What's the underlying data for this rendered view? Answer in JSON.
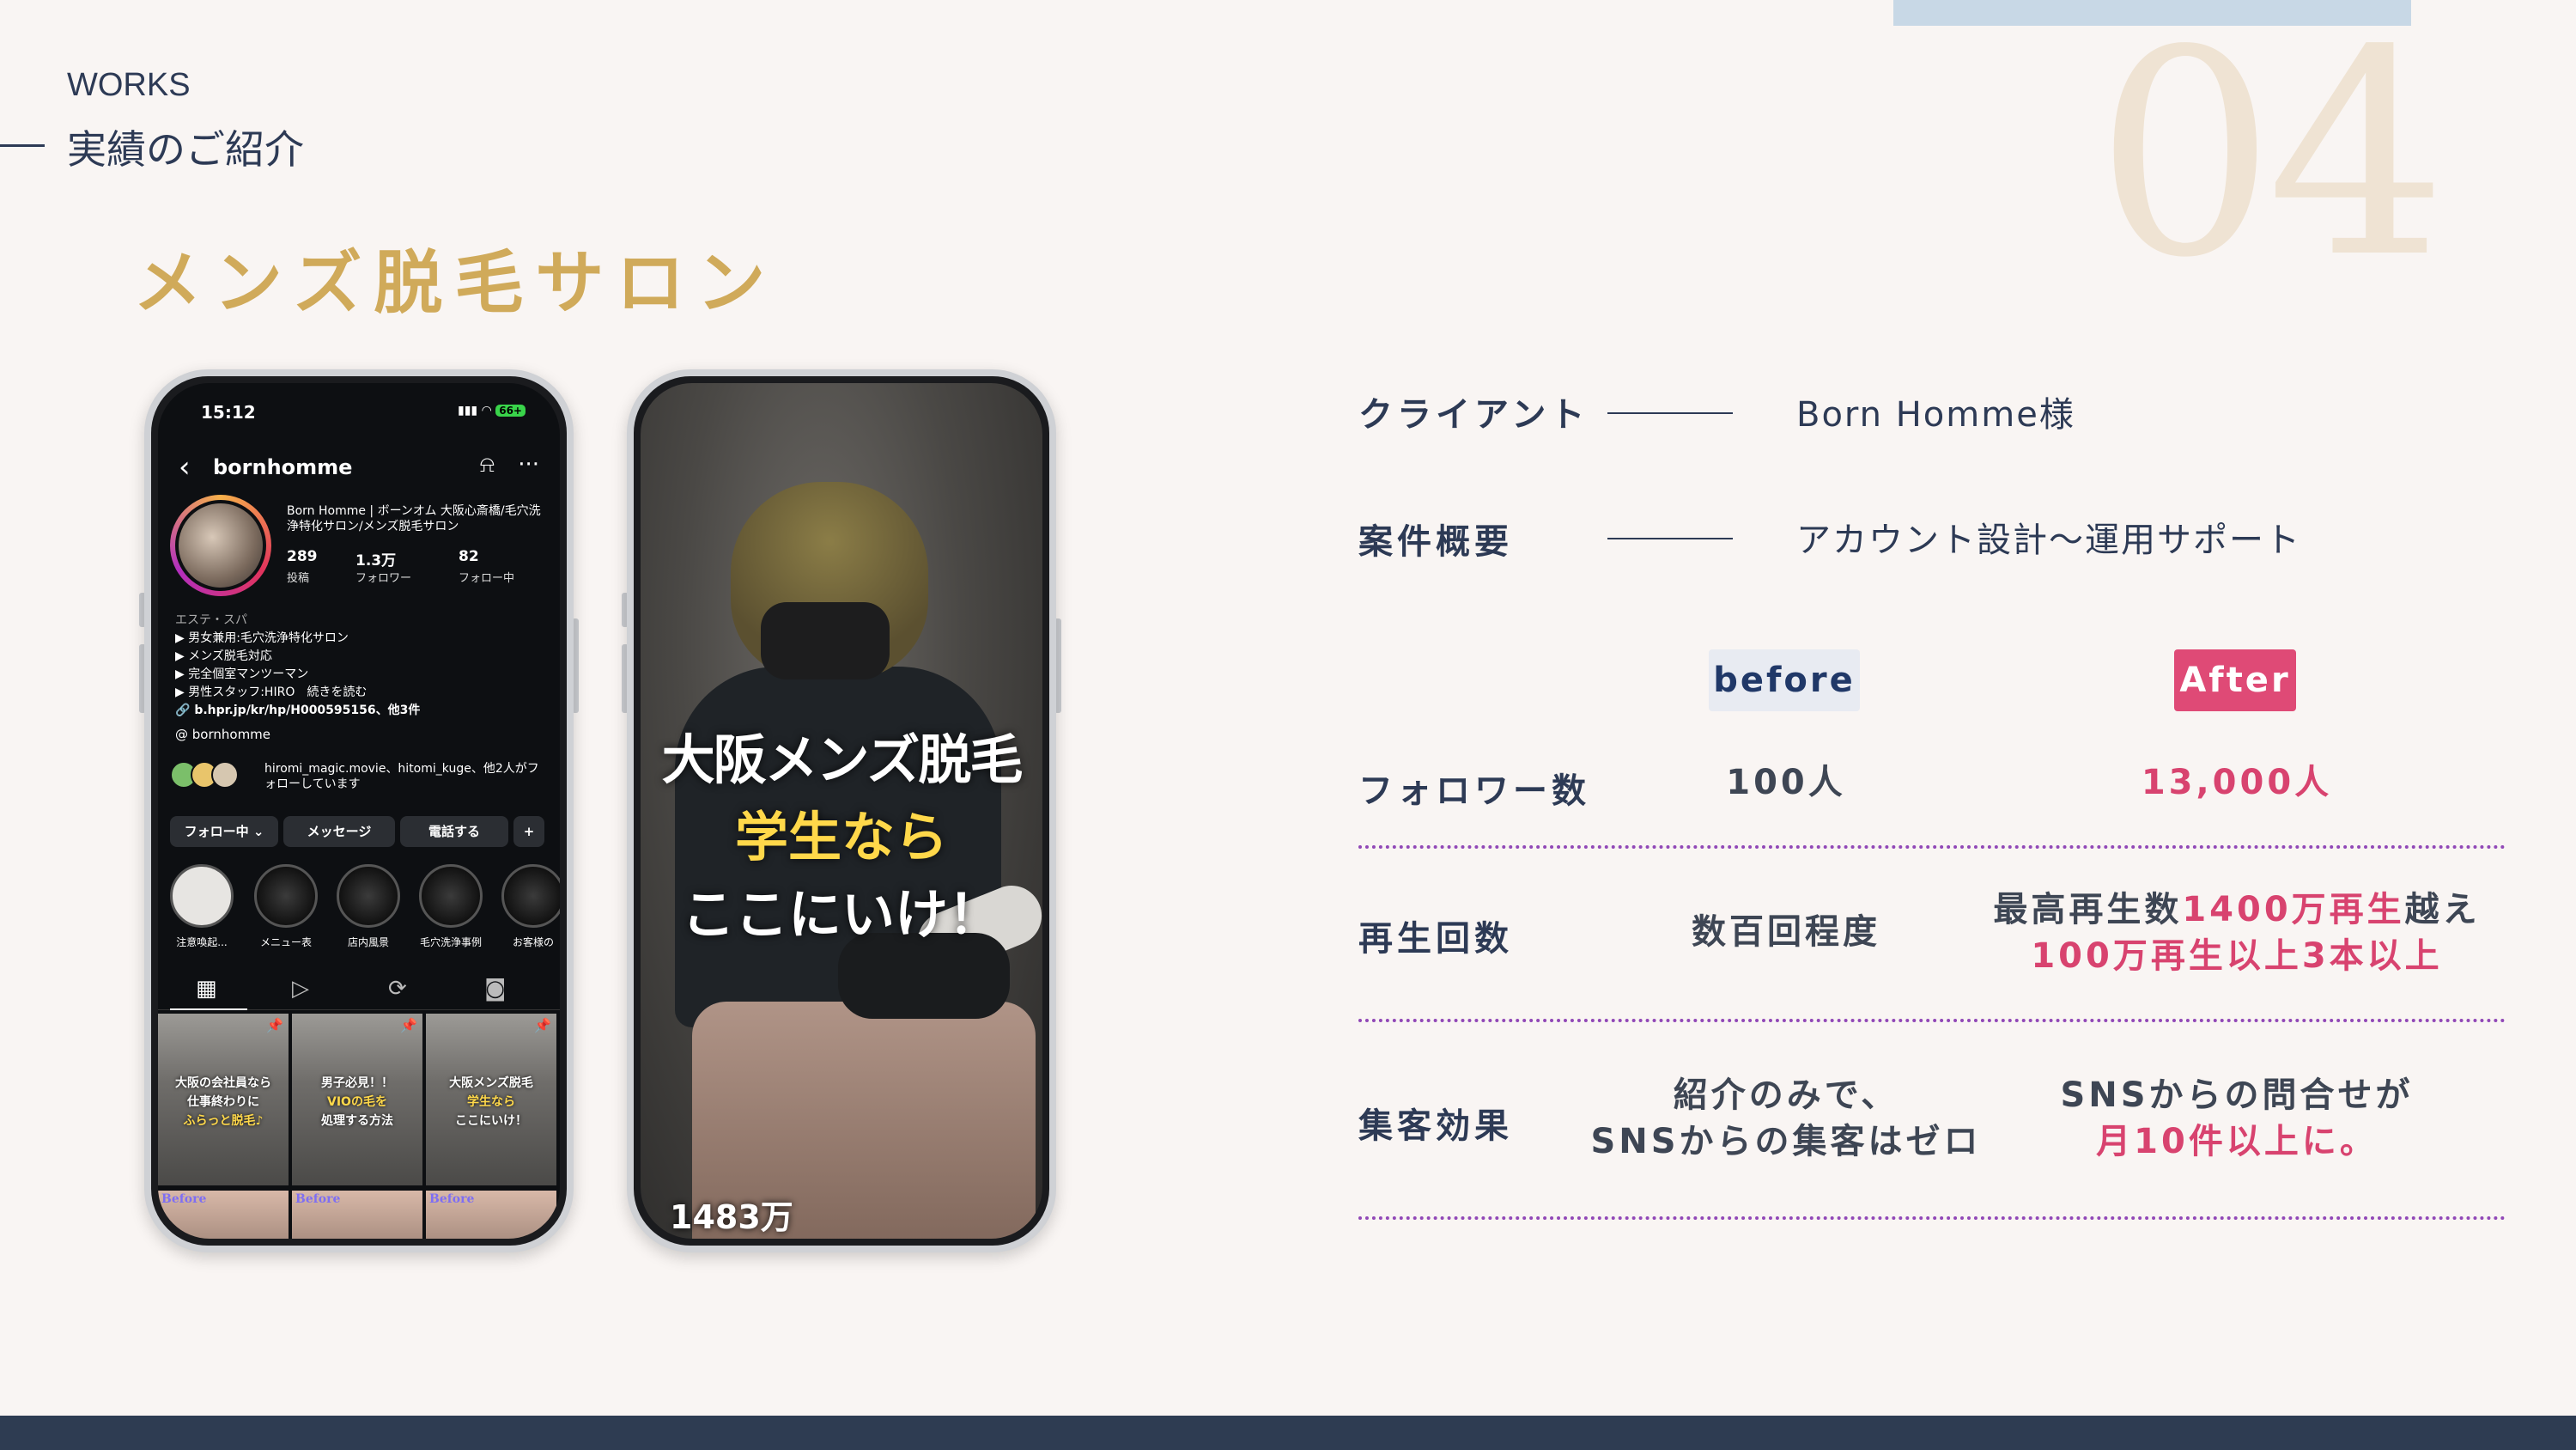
{
  "header": {
    "slide_number": "04",
    "works_label": "WORKS",
    "intro_label": "実績のご紹介",
    "section_title": "メンズ脱毛サロン"
  },
  "instagram": {
    "time": "15:12",
    "battery": "66+",
    "username": "bornhomme",
    "bio_name": "Born Homme | ボーンオム 大阪心斎橋/毛穴洗浄特化サロン/メンズ脱毛サロン",
    "stats": [
      {
        "value": "289",
        "label": "投稿"
      },
      {
        "value": "1.3万",
        "label": "フォロワー"
      },
      {
        "value": "82",
        "label": "フォロー中"
      }
    ],
    "category": "エステ・スパ",
    "bio_lines": [
      "▶ 男女兼用:毛穴洗浄特化サロン",
      "▶ メンズ脱毛対応",
      "▶ 完全個室マンツーマン",
      "▶ 男性スタッフ:HIRO　続きを読む"
    ],
    "link": "b.hpr.jp/kr/hp/H000595156、他3件",
    "threads_handle": "bornhomme",
    "followed_by": "hiromi_magic.movie、hitomi_kuge、他2人がフォローしています",
    "buttons": [
      "フォロー中",
      "メッセージ",
      "電話する"
    ],
    "highlights": [
      "注意喚起...",
      "メニュー表",
      "店内風景",
      "毛穴洗浄事例",
      "お客様の"
    ],
    "grid_posts": [
      {
        "line1": "大阪の会社員なら",
        "line2": "仕事終わりに",
        "line3": "ふらっと脱毛♪"
      },
      {
        "line1": "男子必見！！",
        "line2": "VIOの毛を",
        "line3": "処理する方法"
      },
      {
        "line1": "大阪メンズ脱毛",
        "line2": "学生なら",
        "line3": "ここにいけ！"
      }
    ],
    "before_label": "Before"
  },
  "reel": {
    "line1": "大阪メンズ脱毛",
    "line2": "学生なら",
    "line3": "ここにいけ！",
    "views": "1483万"
  },
  "info": {
    "client_label": "クライアント",
    "client_value": "Born Homme様",
    "summary_label": "案件概要",
    "summary_value": "アカウント設計〜運用サポート"
  },
  "comparison": {
    "before_label": "before",
    "after_label": "After",
    "rows": [
      {
        "label": "フォロワー数",
        "before": "100人",
        "after": "13,000人"
      },
      {
        "label": "再生回数",
        "before": "数百回程度",
        "after_line1_a": "最高再生数",
        "after_line1_b": "1400万再生",
        "after_line1_c": "越え",
        "after_line2": "100万再生以上3本以上"
      },
      {
        "label": "集客効果",
        "before_line1": "紹介のみで、",
        "before_line2": "SNSからの集客はゼロ",
        "after_line1": "SNSからの問合せが",
        "after_line2": "月10件以上に。"
      }
    ]
  },
  "colors": {
    "background": "#f9f5f3",
    "navy": "#2d3a55",
    "gold": "#d0aa5a",
    "pink": "#d8436f",
    "dotted": "#9148b7",
    "footer": "#2e3c52"
  }
}
